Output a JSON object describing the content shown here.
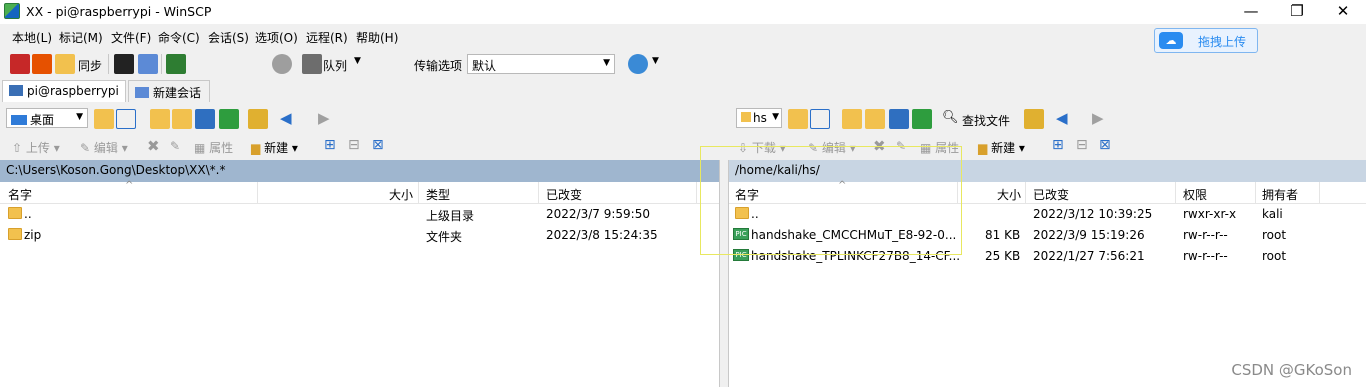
{
  "window": {
    "title": "XX - pi@raspberrypi - WinSCP"
  },
  "menu": [
    "本地(L)",
    "标记(M)",
    "文件(F)",
    "命令(C)",
    "会话(S)",
    "选项(O)",
    "远程(R)",
    "帮助(H)"
  ],
  "toolbar": {
    "sync_label": "同步",
    "queue_label": "队列",
    "transfer_label": "传输选项",
    "transfer_value": "默认"
  },
  "upload_widget": {
    "label": "拖拽上传"
  },
  "tabs": {
    "session": "pi@raspberrypi",
    "new_session": "新建会话"
  },
  "left": {
    "location": "桌面",
    "actions": {
      "upload": "上传",
      "edit": "编辑",
      "props": "属性",
      "new": "新建"
    },
    "path": "C:\\Users\\Koson.Gong\\Desktop\\XX\\*.*",
    "columns": {
      "name": "名字",
      "size": "大小",
      "type": "类型",
      "modified": "已改变"
    },
    "rows": [
      {
        "name": "..",
        "size": "",
        "type": "上级目录",
        "modified": "2022/3/7  9:59:50"
      },
      {
        "name": "zip",
        "size": "",
        "type": "文件夹",
        "modified": "2022/3/8  15:24:35"
      }
    ]
  },
  "right": {
    "location": "hs",
    "find_label": "查找文件",
    "actions": {
      "download": "下载",
      "edit": "编辑",
      "props": "属性",
      "new": "新建"
    },
    "path": "/home/kali/hs/",
    "columns": {
      "name": "名字",
      "size": "大小",
      "modified": "已改变",
      "perms": "权限",
      "owner": "拥有者"
    },
    "rows": [
      {
        "name": "..",
        "size": "",
        "modified": "2022/3/12 10:39:25",
        "perms": "rwxr-xr-x",
        "owner": "kali"
      },
      {
        "name": "handshake_CMCCHMuT_E8-92-0...",
        "size": "81 KB",
        "modified": "2022/3/9 15:19:26",
        "perms": "rw-r--r--",
        "owner": "root"
      },
      {
        "name": "handshake_TPLINKCF27B8_14-CF...",
        "size": "25 KB",
        "modified": "2022/1/27 7:56:21",
        "perms": "rw-r--r--",
        "owner": "root"
      }
    ]
  },
  "watermark": "CSDN @GKoSon"
}
